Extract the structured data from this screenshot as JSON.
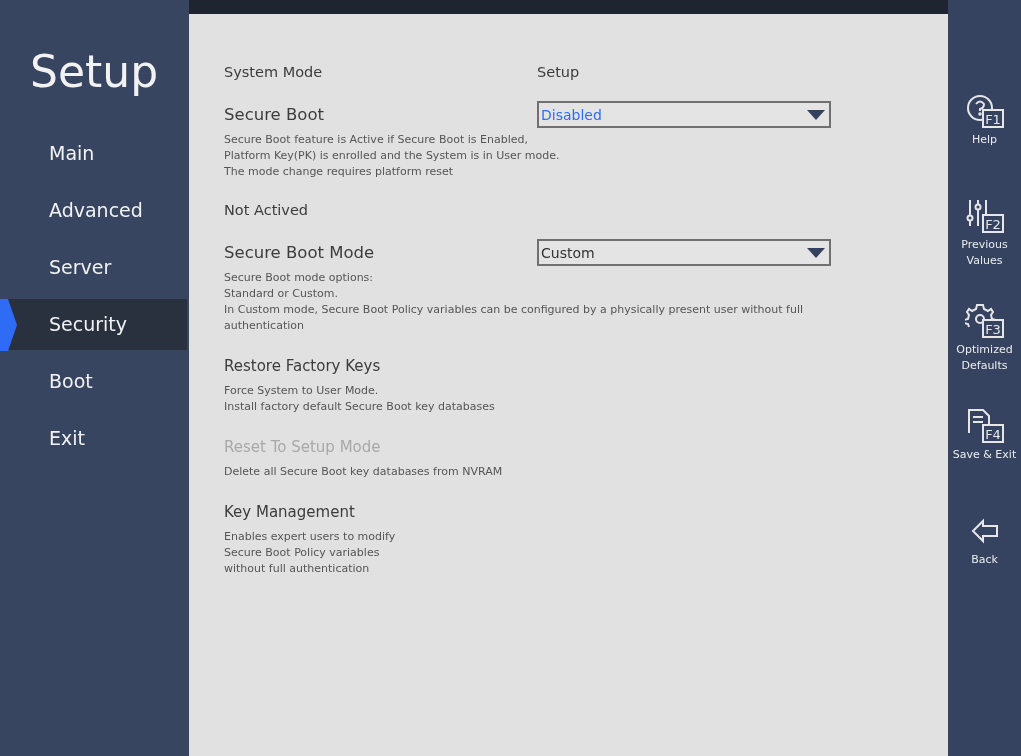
{
  "sidebar": {
    "title": "Setup",
    "items": [
      {
        "label": "Main",
        "selected": false
      },
      {
        "label": "Advanced",
        "selected": false
      },
      {
        "label": "Server",
        "selected": false
      },
      {
        "label": "Security",
        "selected": true
      },
      {
        "label": "Boot",
        "selected": false
      },
      {
        "label": "Exit",
        "selected": false
      }
    ]
  },
  "settings": [
    {
      "kind": "info",
      "label": "System Mode",
      "value": "Setup"
    },
    {
      "kind": "select",
      "label": "Secure Boot",
      "value": "Disabled",
      "focused": true,
      "description": [
        "Secure Boot feature is Active if Secure Boot is Enabled,",
        "Platform Key(PK) is enrolled and the System is in User mode.",
        "The mode change requires platform reset"
      ]
    },
    {
      "kind": "status",
      "label": "Not Actived"
    },
    {
      "kind": "select",
      "label": "Secure Boot Mode",
      "value": "Custom",
      "focused": false,
      "description": [
        "Secure Boot mode options:",
        "Standard or Custom.",
        "In Custom mode, Secure Boot Policy variables can be configured by a physically present user without full authentication"
      ]
    },
    {
      "kind": "action",
      "label": "Restore Factory Keys",
      "disabled": false,
      "description": [
        "Force System to User Mode.",
        "Install factory default Secure Boot key databases"
      ]
    },
    {
      "kind": "action",
      "label": "Reset To Setup Mode",
      "disabled": true,
      "description": [
        "Delete all Secure Boot key databases from NVRAM"
      ]
    },
    {
      "kind": "action",
      "label": "Key Management",
      "disabled": false,
      "description": [
        "Enables expert users to modify",
        "Secure Boot Policy variables",
        "without full authentication"
      ]
    }
  ],
  "hotkeys": [
    {
      "kind": "help",
      "key": "F1",
      "label": [
        "Help"
      ]
    },
    {
      "kind": "sliders",
      "key": "F2",
      "label": [
        "Previous",
        "Values"
      ]
    },
    {
      "kind": "gear",
      "key": "F3",
      "label": [
        "Optimized",
        "Defaults"
      ]
    },
    {
      "kind": "document",
      "key": "F4",
      "label": [
        "Save & Exit"
      ]
    },
    {
      "kind": "back",
      "label": [
        "Back"
      ]
    }
  ]
}
